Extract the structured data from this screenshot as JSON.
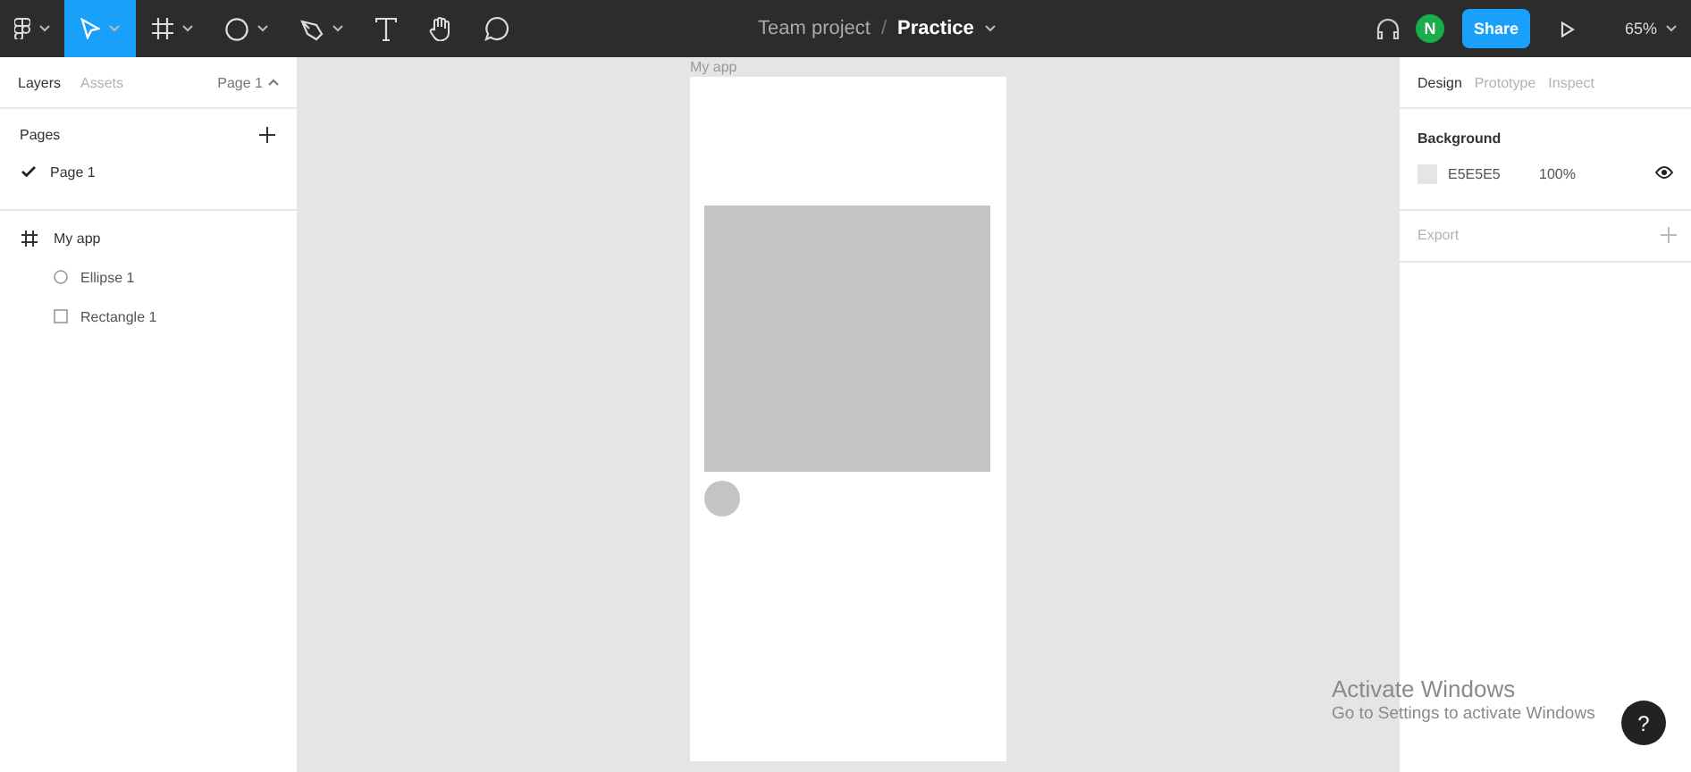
{
  "toolbar": {
    "tools": [
      {
        "kind": "logo",
        "selected": false,
        "dropdown": true
      },
      {
        "kind": "move",
        "selected": true,
        "dropdown": true
      },
      {
        "kind": "frame",
        "selected": false,
        "dropdown": true
      },
      {
        "kind": "ellipse",
        "selected": false,
        "dropdown": true
      },
      {
        "kind": "pen",
        "selected": false,
        "dropdown": true
      },
      {
        "kind": "text",
        "selected": false,
        "dropdown": false
      },
      {
        "kind": "hand",
        "selected": false,
        "dropdown": false
      },
      {
        "kind": "comment",
        "selected": false,
        "dropdown": false
      }
    ],
    "breadcrumb": {
      "project": "Team project",
      "separator": "/",
      "file": "Practice"
    },
    "avatar": "N",
    "share": "Share",
    "zoom": "65%"
  },
  "left_panel": {
    "tabs": [
      {
        "label": "Layers",
        "selected": true
      },
      {
        "label": "Assets",
        "selected": false
      }
    ],
    "page_menu": "Page 1",
    "pages_heading": "Pages",
    "pages": [
      {
        "label": "Page 1",
        "selected": true
      }
    ],
    "layers": [
      {
        "kind": "frame",
        "label": "My app",
        "children": [
          {
            "kind": "ellipse",
            "label": "Ellipse 1"
          },
          {
            "kind": "rectangle",
            "label": "Rectangle 1"
          }
        ]
      }
    ]
  },
  "canvas": {
    "frame_label": "My app",
    "shapes": [
      {
        "kind": "rectangle"
      },
      {
        "kind": "ellipse"
      }
    ]
  },
  "right_panel": {
    "tabs": [
      {
        "label": "Design",
        "selected": true
      },
      {
        "label": "Prototype",
        "selected": false
      },
      {
        "label": "Inspect",
        "selected": false
      }
    ],
    "background": {
      "heading": "Background",
      "hex": "E5E5E5",
      "opacity": "100%",
      "visible": true
    },
    "export": {
      "heading": "Export"
    }
  },
  "os_notice": {
    "title": "Activate Windows",
    "message": "Go to Settings to activate Windows"
  },
  "help": "?"
}
